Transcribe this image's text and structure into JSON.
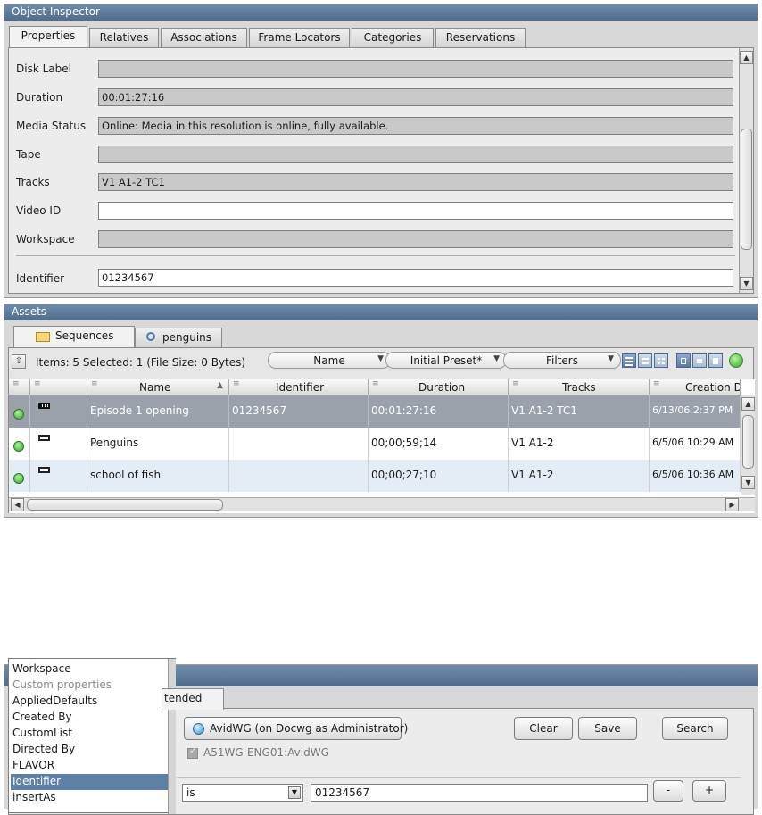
{
  "inspector": {
    "title": "Object Inspector",
    "tabs": [
      "Properties",
      "Relatives",
      "Associations",
      "Frame Locators",
      "Categories",
      "Reservations"
    ],
    "properties": [
      {
        "label": "Disk Label",
        "value": ""
      },
      {
        "label": "Duration",
        "value": "00:01:27:16"
      },
      {
        "label": "Media Status",
        "value": "Online: Media in this resolution is online, fully available."
      },
      {
        "label": "Tape",
        "value": ""
      },
      {
        "label": "Tracks",
        "value": "V1 A1-2 TC1"
      },
      {
        "label": "Video ID",
        "value": ""
      },
      {
        "label": "Workspace",
        "value": ""
      },
      {
        "label": "Identifier",
        "value": "01234567"
      }
    ]
  },
  "assets": {
    "title": "Assets",
    "tabs": [
      "Sequences",
      "penguins"
    ],
    "items_summary": "Items: 5 Selected: 1 (File Size: 0 Bytes)",
    "sort_by": "Name",
    "preset": "Initial Preset*",
    "filters": "Filters",
    "columns": [
      "Name",
      "Identifier",
      "Duration",
      "Tracks",
      "Creation D"
    ],
    "rows": [
      {
        "name": "Episode 1 opening",
        "identifier": "01234567",
        "duration": "00:01:27:16",
        "tracks": "V1 A1-2 TC1",
        "created": "6/13/06 2:37 PM",
        "selected": true
      },
      {
        "name": "Penguins",
        "identifier": "",
        "duration": "00;00;59;14",
        "tracks": "V1 A1-2",
        "created": "6/5/06 10:29 AM",
        "selected": false
      },
      {
        "name": "school of fish",
        "identifier": "",
        "duration": "00;00;27;10",
        "tracks": "V1 A1-2",
        "created": "6/5/06 10:36 AM",
        "selected": false
      }
    ]
  },
  "search": {
    "tab_partial": "tended",
    "workgroup_button": "AvidWG (on Docwg as Administrator)",
    "clear": "Clear",
    "save": "Save",
    "search": "Search",
    "workgroup_check": "A51WG-ENG01:AvidWG",
    "operator": "is",
    "value": "01234567",
    "minus": "-",
    "plus": "+"
  },
  "property_list": {
    "items": [
      {
        "label": "Workspace",
        "style": "normal"
      },
      {
        "label": "Custom properties",
        "style": "grey"
      },
      {
        "label": "AppliedDefaults",
        "style": "normal"
      },
      {
        "label": "Created By",
        "style": "normal"
      },
      {
        "label": "CustomList",
        "style": "normal"
      },
      {
        "label": "Directed By",
        "style": "normal"
      },
      {
        "label": "FLAVOR",
        "style": "normal"
      },
      {
        "label": "Identifier",
        "style": "selected"
      },
      {
        "label": "insertAs",
        "style": "normal"
      }
    ]
  },
  "colors": {
    "titlebar": "#5f7b9b",
    "selection": "#5e7fa6",
    "selected_row": "#9aa1ab",
    "alt_row": "#e4edf5",
    "status_green": "#3cb33a"
  }
}
